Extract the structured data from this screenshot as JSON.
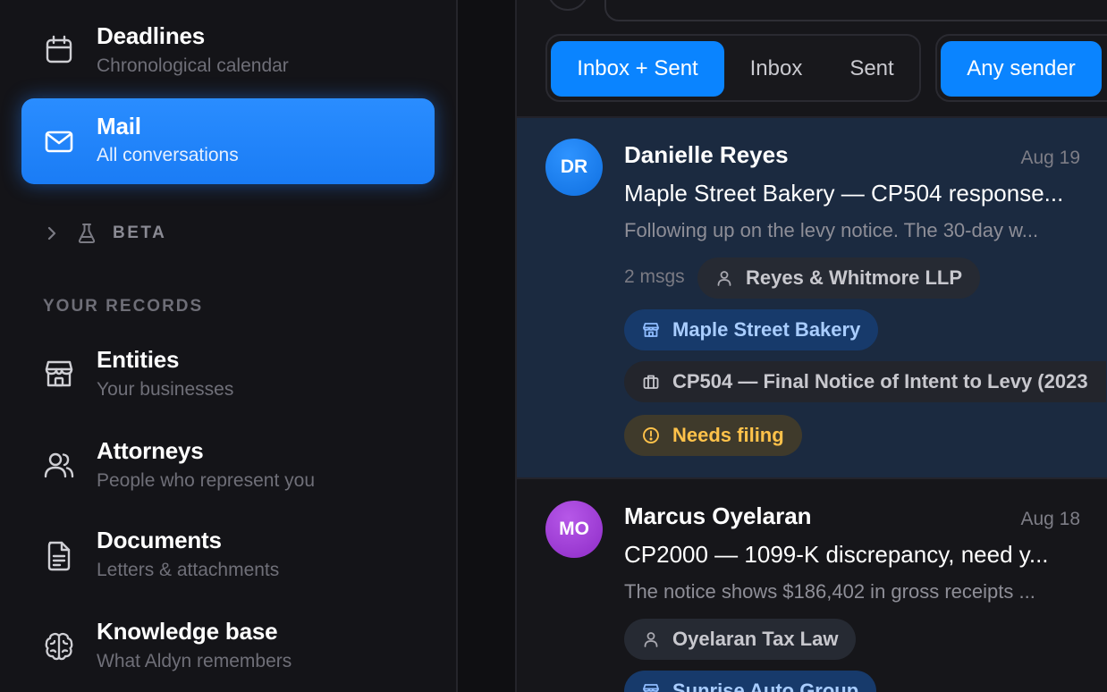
{
  "sidebar": {
    "items": [
      {
        "title": "Deadlines",
        "subtitle": "Chronological calendar",
        "icon": "calendar-icon",
        "active": false
      },
      {
        "title": "Mail",
        "subtitle": "All conversations",
        "icon": "mail-icon",
        "active": true
      }
    ],
    "beta_label": "BETA",
    "section_label": "YOUR RECORDS",
    "records": [
      {
        "title": "Entities",
        "subtitle": "Your businesses",
        "icon": "storefront-icon"
      },
      {
        "title": "Attorneys",
        "subtitle": "People who represent you",
        "icon": "people-icon"
      },
      {
        "title": "Documents",
        "subtitle": "Letters & attachments",
        "icon": "document-icon"
      },
      {
        "title": "Knowledge base",
        "subtitle": "What Aldyn remembers",
        "icon": "brain-icon"
      }
    ]
  },
  "filters": {
    "mailbox": [
      "Inbox + Sent",
      "Inbox",
      "Sent"
    ],
    "mailbox_selected": "Inbox + Sent",
    "sender": [
      "Any sender"
    ],
    "sender_selected": "Any sender"
  },
  "colors": {
    "accent": "#0a84ff",
    "selected_row": "#1b2a40",
    "needs_filing": "#ffc24a"
  },
  "messages": [
    {
      "initials": "DR",
      "sender": "Danielle Reyes",
      "date": "Aug 19",
      "subject": "Maple Street Bakery — CP504 response...",
      "preview": "Following up on the levy notice. The 30-day w...",
      "count": "2 msgs",
      "attorney": "Reyes & Whitmore LLP",
      "entity": "Maple Street Bakery",
      "notice": "CP504 — Final Notice of Intent to Levy (2023",
      "status": "Needs filing",
      "avatar_color": "#1a7cf5"
    },
    {
      "initials": "MO",
      "sender": "Marcus Oyelaran",
      "date": "Aug 18",
      "subject": "CP2000 — 1099-K discrepancy, need y...",
      "preview": "The notice shows $186,402 in gross receipts ...",
      "attorney": "Oyelaran Tax Law",
      "entity": "Sunrise Auto Group",
      "avatar_color": "#a23fd6"
    }
  ]
}
